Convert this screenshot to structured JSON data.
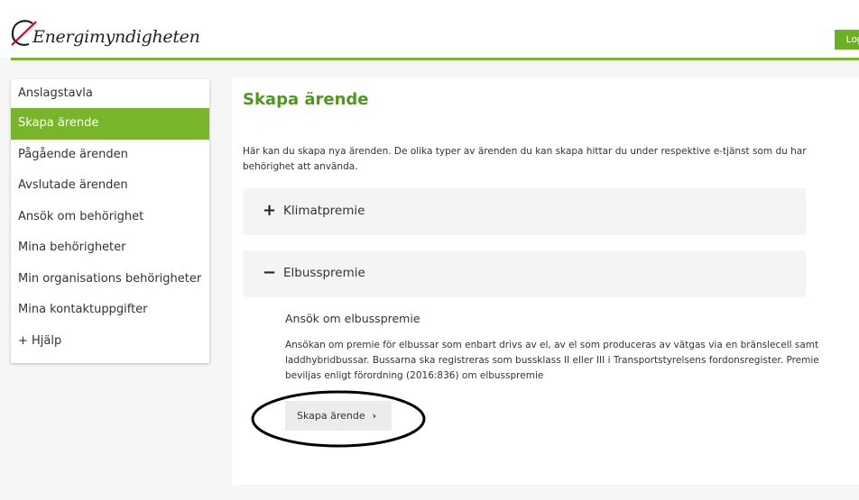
{
  "header": {
    "logo_text": "Energimyndigheten",
    "logout_label": "Logga ut",
    "accent_color": "#78b52a",
    "logo_mark_color": "#e0001b"
  },
  "sidebar": {
    "items": [
      {
        "label": "Anslagstavla"
      },
      {
        "label": "Skapa ärende",
        "active": true
      },
      {
        "label": "Pågående ärenden"
      },
      {
        "label": "Avslutade ärenden"
      },
      {
        "label": "Ansök om behörighet"
      },
      {
        "label": "Mina behörigheter"
      },
      {
        "label": "Min organisations behörigheter"
      },
      {
        "label": "Mina kontaktuppgifter"
      },
      {
        "label": "+ Hjälp"
      }
    ]
  },
  "main": {
    "title": "Skapa ärende",
    "intro": "Här kan du skapa nya ärenden. De olika typer av ärenden du kan skapa hittar du under respektive e-tjänst som du har behörighet att använda.",
    "panels": [
      {
        "sign": "+",
        "label": "Klimatpremie",
        "expanded": false
      },
      {
        "sign": "−",
        "label": "Elbusspremie",
        "expanded": true
      }
    ],
    "subhead": "Ansök om elbusspremie",
    "description": "Ansökan om premie för elbussar som enbart drivs av el, av el som produceras av vätgas via en bränslecell samt laddhybridbussar. Bussarna ska registreras som bussklass II eller III i Transportstyrelsens fordonsregister. Premie beviljas enligt förordning (2016:836) om elbusspremie",
    "create_button": "Skapa ärende",
    "create_button_icon": "chevron-right-icon"
  }
}
